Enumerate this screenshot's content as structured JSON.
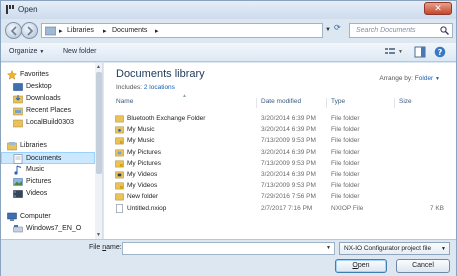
{
  "window": {
    "title": "Open"
  },
  "nav": {
    "breadcrumb": [
      "Libraries",
      "Documents"
    ],
    "search_placeholder": "Search Documents"
  },
  "toolbar": {
    "organize": "Organize",
    "new_folder": "New folder"
  },
  "sidebar": {
    "favorites": "Favorites",
    "fav_items": [
      "Desktop",
      "Downloads",
      "Recent Places",
      "LocalBuild0303"
    ],
    "libraries": "Libraries",
    "lib_items": [
      "Documents",
      "Music",
      "Pictures",
      "Videos"
    ],
    "computer": "Computer",
    "comp_items": [
      "Windows7_EN_O"
    ]
  },
  "library": {
    "title": "Documents library",
    "includes_label": "Includes:",
    "includes_link": "2 locations",
    "arrange_label": "Arrange by:",
    "arrange_value": "Folder"
  },
  "columns": {
    "name": "Name",
    "date": "Date modified",
    "type": "Type",
    "size": "Size"
  },
  "files": [
    {
      "name": "Bluetooth Exchange Folder",
      "date": "3/20/2014 6:39 PM",
      "type": "File folder",
      "size": "",
      "icon": "folder"
    },
    {
      "name": "My Music",
      "date": "3/20/2014 6:39 PM",
      "type": "File folder",
      "size": "",
      "icon": "folder-music"
    },
    {
      "name": "My Music",
      "date": "7/13/2009 9:53 PM",
      "type": "File folder",
      "size": "",
      "icon": "folder-lock"
    },
    {
      "name": "My Pictures",
      "date": "3/20/2014 6:39 PM",
      "type": "File folder",
      "size": "",
      "icon": "folder-pictures"
    },
    {
      "name": "My Pictures",
      "date": "7/13/2009 9:53 PM",
      "type": "File folder",
      "size": "",
      "icon": "folder-lock"
    },
    {
      "name": "My Videos",
      "date": "3/20/2014 6:39 PM",
      "type": "File folder",
      "size": "",
      "icon": "folder-videos"
    },
    {
      "name": "My Videos",
      "date": "7/13/2009 9:53 PM",
      "type": "File folder",
      "size": "",
      "icon": "folder-lock"
    },
    {
      "name": "New folder",
      "date": "7/29/2016 7:56 PM",
      "type": "File folder",
      "size": "",
      "icon": "folder"
    },
    {
      "name": "Untitled.nxiop",
      "date": "2/7/2017 7:16 PM",
      "type": "NXIOP File",
      "size": "7 KB",
      "icon": "file"
    }
  ],
  "bottom": {
    "file_name_label_pre": "File ",
    "file_name_label_u": "n",
    "file_name_label_post": "ame:",
    "file_name_value": "",
    "file_type": "NX-IO Configurator project file",
    "open_u": "O",
    "open_rest": "pen",
    "cancel": "Cancel"
  },
  "colors": {
    "folder": "#e8c25a",
    "accent": "#1a5fb4",
    "close": "#c4472c"
  }
}
